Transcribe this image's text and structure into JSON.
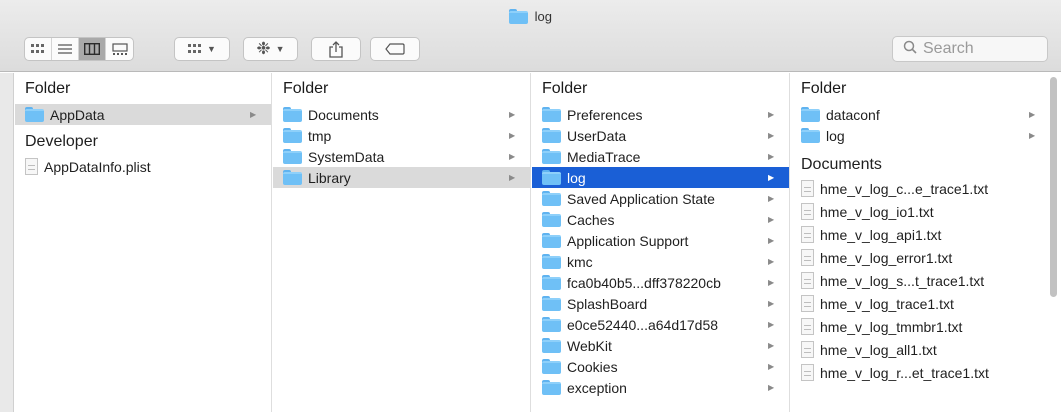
{
  "window": {
    "title": "log"
  },
  "toolbar": {
    "view_modes": [
      "icon-view-icon",
      "list-view-icon",
      "column-view-icon",
      "gallery-view-icon"
    ],
    "group_icon": "group-icon",
    "action_icon": "gear-icon",
    "share_icon": "share-icon",
    "tag_icon": "tag-icon",
    "search_placeholder": "Search"
  },
  "columns": [
    {
      "header": "Folder",
      "items": [
        {
          "name": "AppData",
          "kind": "folder",
          "selected": "gray"
        }
      ],
      "section2_header": "Developer",
      "files": [
        "AppDataInfo.plist"
      ]
    },
    {
      "header": "Folder",
      "items": [
        {
          "name": "Documents",
          "kind": "folder"
        },
        {
          "name": "tmp",
          "kind": "folder"
        },
        {
          "name": "SystemData",
          "kind": "folder"
        },
        {
          "name": "Library",
          "kind": "folder",
          "selected": "gray"
        }
      ]
    },
    {
      "header": "Folder",
      "items": [
        {
          "name": "Preferences"
        },
        {
          "name": "UserData"
        },
        {
          "name": "MediaTrace"
        },
        {
          "name": "log",
          "selected": "blue"
        },
        {
          "name": "Saved Application State"
        },
        {
          "name": "Caches"
        },
        {
          "name": "Application Support"
        },
        {
          "name": "kmc"
        },
        {
          "name": "fca0b40b5...dff378220cb"
        },
        {
          "name": "SplashBoard"
        },
        {
          "name": "e0ce52440...a64d17d58"
        },
        {
          "name": "WebKit"
        },
        {
          "name": "Cookies"
        },
        {
          "name": "exception"
        }
      ]
    },
    {
      "header": "Folder",
      "items": [
        {
          "name": "dataconf"
        },
        {
          "name": "log"
        }
      ],
      "section2_header": "Documents",
      "files": [
        "hme_v_log_c...e_trace1.txt",
        "hme_v_log_io1.txt",
        "hme_v_log_api1.txt",
        "hme_v_log_error1.txt",
        "hme_v_log_s...t_trace1.txt",
        "hme_v_log_trace1.txt",
        "hme_v_log_tmmbr1.txt",
        "hme_v_log_all1.txt",
        "hme_v_log_r...et_trace1.txt"
      ]
    }
  ]
}
